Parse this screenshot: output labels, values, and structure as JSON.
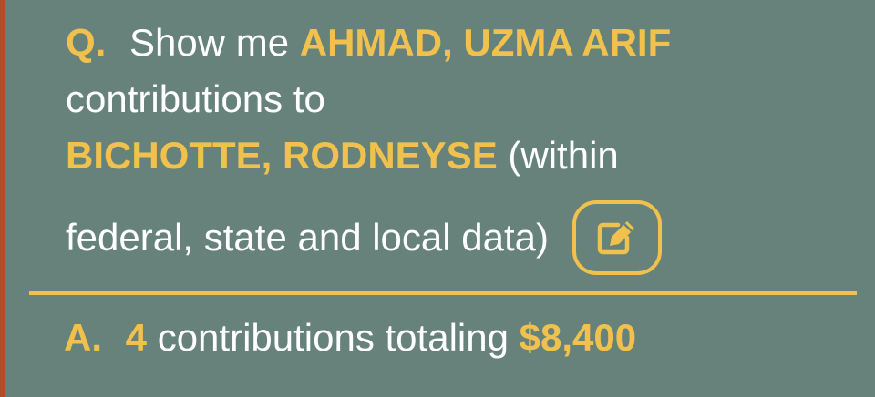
{
  "question": {
    "label": "Q.",
    "prefix": "Show me",
    "contributor": "AHMAD, UZMA ARIF",
    "middle": "contributions to",
    "recipient": "BICHOTTE, RODNEYSE",
    "scope_open": "(within",
    "scope_close": "federal, state and local data)"
  },
  "answer": {
    "label": "A.",
    "count": "4",
    "middle": "contributions totaling",
    "total": "$8,400"
  },
  "icons": {
    "edit": "edit-icon"
  },
  "colors": {
    "background": "#66827a",
    "accent": "#f1c14e",
    "text": "#ffffff",
    "edge": "#b44a2e"
  }
}
